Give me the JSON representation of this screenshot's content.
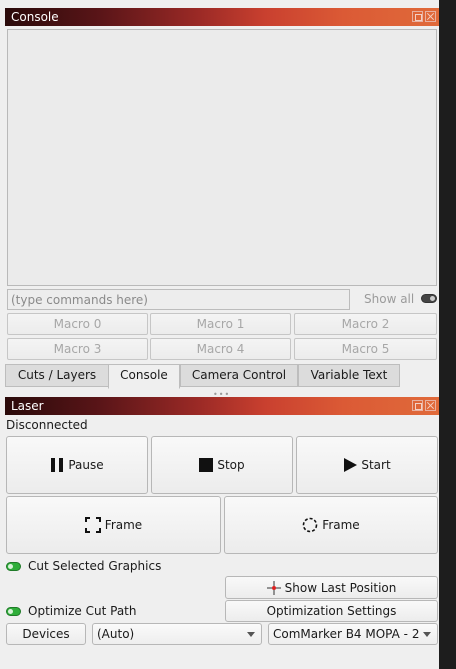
{
  "console_panel": {
    "title": "Console",
    "command_placeholder": "(type commands here)",
    "show_all_label": "Show all",
    "macros": [
      "Macro 0",
      "Macro 1",
      "Macro 2",
      "Macro 3",
      "Macro 4",
      "Macro 5"
    ]
  },
  "tabs": [
    {
      "label": "Cuts / Layers",
      "active": false
    },
    {
      "label": "Console",
      "active": true
    },
    {
      "label": "Camera Control",
      "active": false
    },
    {
      "label": "Variable Text",
      "active": false
    }
  ],
  "laser_panel": {
    "title": "Laser",
    "status": "Disconnected",
    "pause_label": "Pause",
    "stop_label": "Stop",
    "start_label": "Start",
    "frame_rect_label": "Frame",
    "frame_circle_label": "Frame",
    "cut_selected_label": "Cut Selected Graphics",
    "show_last_position_label": "Show Last Position",
    "optimize_cut_path_label": "Optimize Cut Path",
    "optimization_settings_label": "Optimization Settings",
    "devices_label": "Devices",
    "port_select_value": "(Auto)",
    "device_select_value": "ComMarker B4 MOPA - 2"
  },
  "colors": {
    "titlebar_dark": "#2a0a0a",
    "titlebar_mid": "#c9402f",
    "titlebar_light": "#e06a3a",
    "switch_on": "#2fae3a",
    "position_marker": "#d92020"
  }
}
